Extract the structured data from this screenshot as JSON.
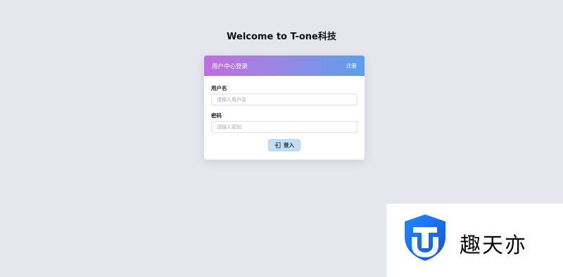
{
  "page": {
    "title": "Welcome to T-one科技"
  },
  "card": {
    "header_title": "用户中心登录",
    "register_label": "注册",
    "username": {
      "label": "用户名",
      "placeholder": "请输入用户名",
      "value": ""
    },
    "password": {
      "label": "密码",
      "placeholder": "请输入密码",
      "value": ""
    },
    "login_button": {
      "label": "登入",
      "icon": "login-icon"
    },
    "header_gradient": [
      "#c06ee0",
      "#5aa1ea"
    ]
  },
  "watermark": {
    "brand_name": "趣天亦",
    "icon": "shield-logo",
    "brand_color": "#1f6fe0"
  }
}
